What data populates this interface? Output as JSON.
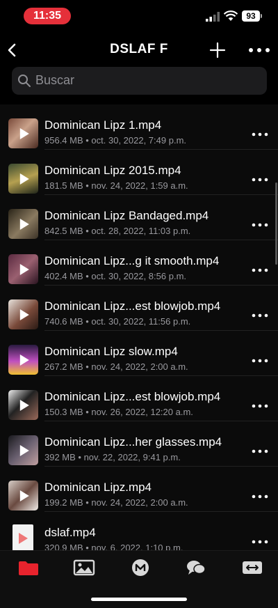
{
  "status": {
    "time": "11:35",
    "battery": "93",
    "time_color": "#e5303a"
  },
  "nav": {
    "title": "DSLAF F",
    "icons": [
      "chevron-left-icon",
      "plus-icon",
      "more-horizontal-icon"
    ]
  },
  "search": {
    "placeholder": "Buscar"
  },
  "files": [
    {
      "name": "Dominican Lipz 1.mp4",
      "meta": "956.4 MB • oct. 30, 2022, 7:49 p.m."
    },
    {
      "name": "Dominican Lipz 2015.mp4",
      "meta": "181.5 MB • nov. 24, 2022, 1:59 a.m."
    },
    {
      "name": "Dominican Lipz Bandaged.mp4",
      "meta": "842.5 MB • oct. 28, 2022, 11:03 p.m."
    },
    {
      "name": "Dominican Lipz...g it smooth.mp4",
      "meta": "402.4 MB • oct. 30, 2022, 8:56 p.m."
    },
    {
      "name": "Dominican Lipz...est blowjob.mp4",
      "meta": "740.6 MB • oct. 30, 2022, 11:56 p.m."
    },
    {
      "name": "Dominican Lipz slow.mp4",
      "meta": "267.2 MB • nov. 24, 2022, 2:00 a.m."
    },
    {
      "name": "Dominican Lipz...est blowjob.mp4",
      "meta": "150.3 MB • nov. 26, 2022, 12:20 a.m."
    },
    {
      "name": "Dominican Lipz...her glasses.mp4",
      "meta": "392 MB • nov. 22, 2022, 9:41 p.m."
    },
    {
      "name": "Dominican Lipz.mp4",
      "meta": "199.2 MB • nov. 24, 2022, 2:00 a.m."
    },
    {
      "name": "dslaf.mp4",
      "meta": "320.9 MB • nov. 6, 2022, 1:10 p.m."
    }
  ],
  "tabbar": {
    "accent": "#e8232d",
    "tabs": [
      "folder-icon",
      "photo-icon",
      "m-circle-icon",
      "chat-bubbles-icon",
      "transfer-icon"
    ]
  }
}
